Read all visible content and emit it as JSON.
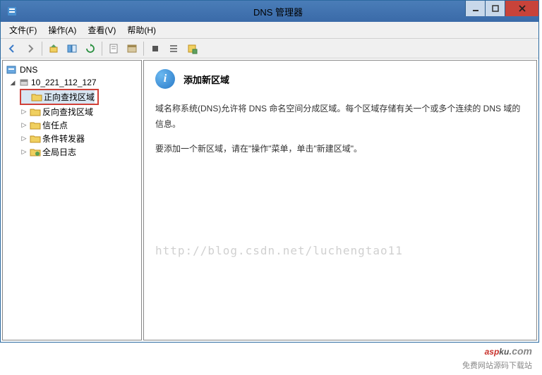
{
  "window": {
    "title": "DNS 管理器"
  },
  "menu": {
    "file": "文件(F)",
    "action": "操作(A)",
    "view": "查看(V)",
    "help": "帮助(H)"
  },
  "tree": {
    "root": "DNS",
    "server": "10_221_112_127",
    "forward_lookup": "正向查找区域",
    "reverse_lookup": "反向查找区域",
    "trust_points": "信任点",
    "conditional_fwd": "条件转发器",
    "global_logs": "全局日志"
  },
  "detail": {
    "title": "添加新区域",
    "para1": "域名称系统(DNS)允许将 DNS 命名空间分成区域。每个区域存储有关一个或多个连续的 DNS 域的信息。",
    "para2": "要添加一个新区域，请在\"操作\"菜单，单击\"新建区域\"。"
  },
  "watermark": "http://blog.csdn.net/luchengtao11",
  "brand": {
    "asp": "asp",
    "ku": "ku",
    "com": ".com",
    "sub": "免费网站源码下载站"
  }
}
